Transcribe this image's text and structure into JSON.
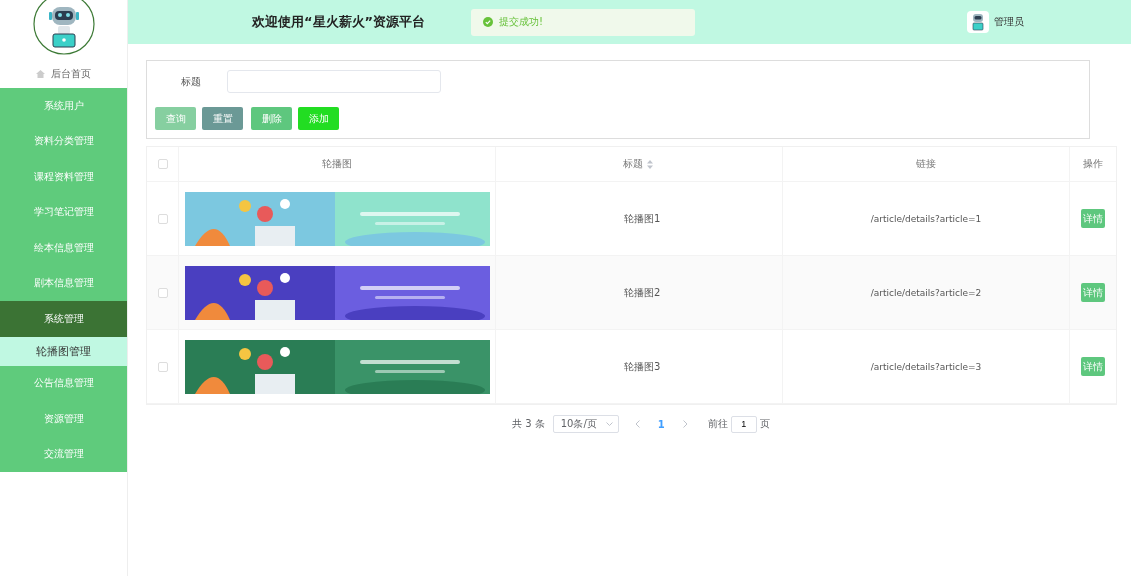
{
  "sidebar": {
    "home": "后台首页",
    "menu": [
      {
        "label": "系统用户",
        "selected": false
      },
      {
        "label": "资料分类管理",
        "selected": false
      },
      {
        "label": "课程资料管理",
        "selected": false
      },
      {
        "label": "学习笔记管理",
        "selected": false
      },
      {
        "label": "绘本信息管理",
        "selected": false
      },
      {
        "label": "剧本信息管理",
        "selected": false
      },
      {
        "label": "系统管理",
        "selected": true,
        "children": [
          {
            "label": "轮播图管理",
            "selected": true
          }
        ]
      },
      {
        "label": "公告信息管理",
        "selected": false
      },
      {
        "label": "资源管理",
        "selected": false
      },
      {
        "label": "交流管理",
        "selected": false
      }
    ]
  },
  "header": {
    "title": "欢迎使用“星火薪火”资源平台",
    "toast": "提交成功!",
    "user": "管理员"
  },
  "search": {
    "label": "标题",
    "buttons": [
      {
        "label": "查询",
        "kind": "query"
      },
      {
        "label": "重置",
        "kind": "reset"
      },
      {
        "label": "删除",
        "kind": "delete"
      },
      {
        "label": "添加",
        "kind": "add"
      }
    ]
  },
  "table": {
    "all_checked": false,
    "columns": [
      {
        "label": "轮播图",
        "sortable": false
      },
      {
        "label": "标题",
        "sortable": true
      },
      {
        "label": "链接",
        "sortable": false
      },
      {
        "label": "操作",
        "sortable": false
      }
    ],
    "rows": [
      {
        "checked": false,
        "title": "轮播图1",
        "link": "/article/details?article=1",
        "action": "详情"
      },
      {
        "checked": false,
        "title": "轮播图2",
        "link": "/article/details?article=2",
        "action": "详情"
      },
      {
        "checked": false,
        "title": "轮播图3",
        "link": "/article/details?article=3",
        "action": "详情"
      }
    ]
  },
  "pagination": {
    "total": "共 3 条",
    "page_size": "10条/页",
    "pages": [
      {
        "label": "1",
        "selected": true
      }
    ],
    "goto_label": "前往",
    "goto_value": "1",
    "page_unit": "页"
  }
}
